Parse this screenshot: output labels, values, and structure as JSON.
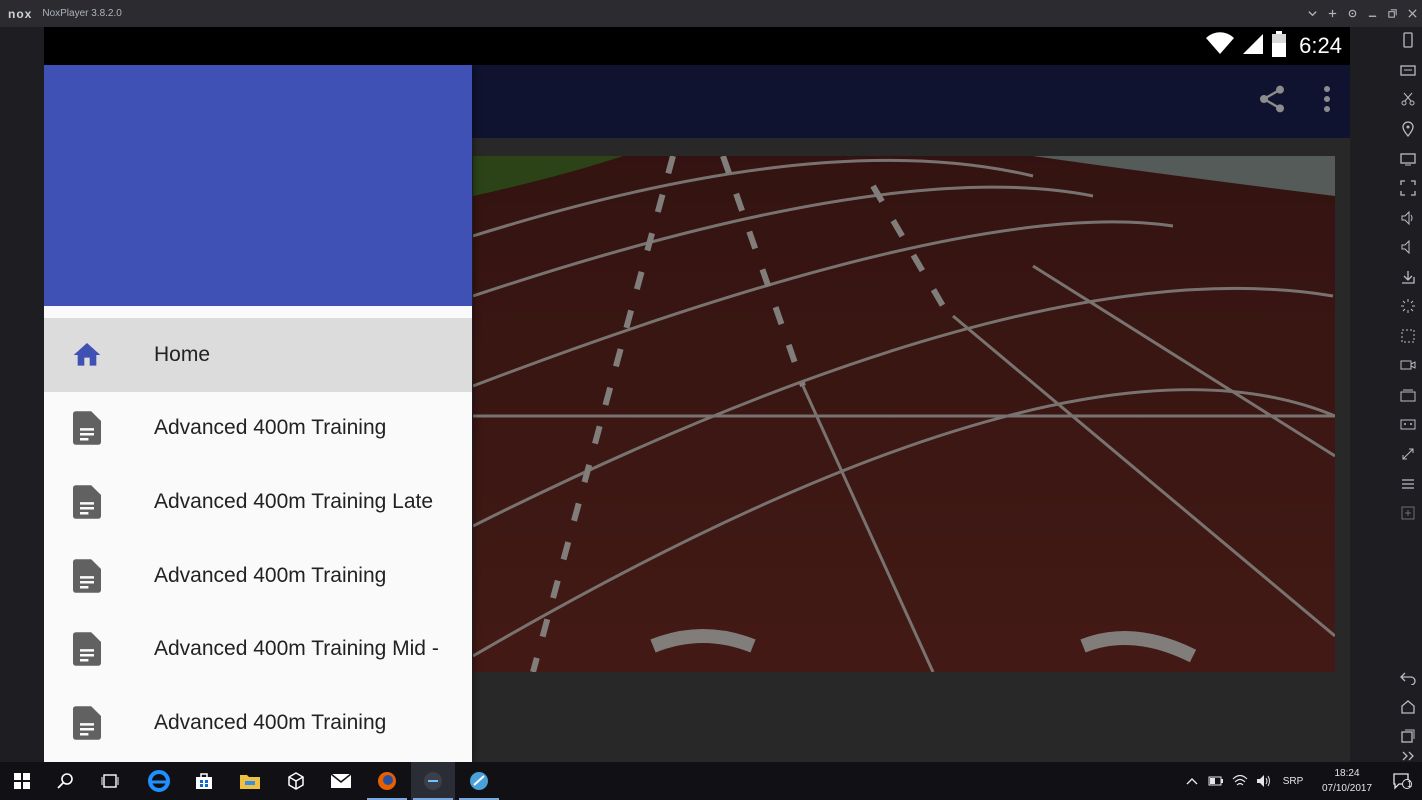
{
  "emulator": {
    "logo": "nox",
    "title": "NoxPlayer 3.8.2.0",
    "title_controls": [
      "chevron-down-icon",
      "pin-icon",
      "settings-icon",
      "minimize-icon",
      "restore-icon",
      "close-icon"
    ]
  },
  "android": {
    "status_time": "6:24",
    "status_icons": [
      "wifi-icon",
      "signal-icon",
      "battery-icon"
    ]
  },
  "appbar": {
    "color": "#1c2457",
    "actions": [
      "share-icon",
      "more-vert-icon"
    ]
  },
  "drawer": {
    "header_color": "#3f51b5",
    "items": [
      {
        "label": "Home",
        "icon": "home-icon",
        "active": true
      },
      {
        "label": "Advanced 400m Training",
        "icon": "document-icon",
        "active": false
      },
      {
        "label": "Advanced 400m Training Late",
        "icon": "document-icon",
        "active": false
      },
      {
        "label": "Advanced 400m Training",
        "icon": "document-icon",
        "active": false
      },
      {
        "label": "Advanced 400m Training Mid -",
        "icon": "document-icon",
        "active": false
      },
      {
        "label": "Advanced 400m Training",
        "icon": "document-icon",
        "active": false
      }
    ]
  },
  "content": {
    "hero_image": "running-track-image"
  },
  "taskbar": {
    "apps": [
      "windows-start-icon",
      "search-icon",
      "task-view-icon",
      "edge-icon",
      "store-icon",
      "file-explorer-icon",
      "unity-icon",
      "mail-icon",
      "firefox-icon",
      "nox-icon",
      "other-app-icon"
    ],
    "tray_language": "SRP",
    "tray_time": "18:24",
    "tray_date": "07/10/2017",
    "notification_count": "1"
  }
}
